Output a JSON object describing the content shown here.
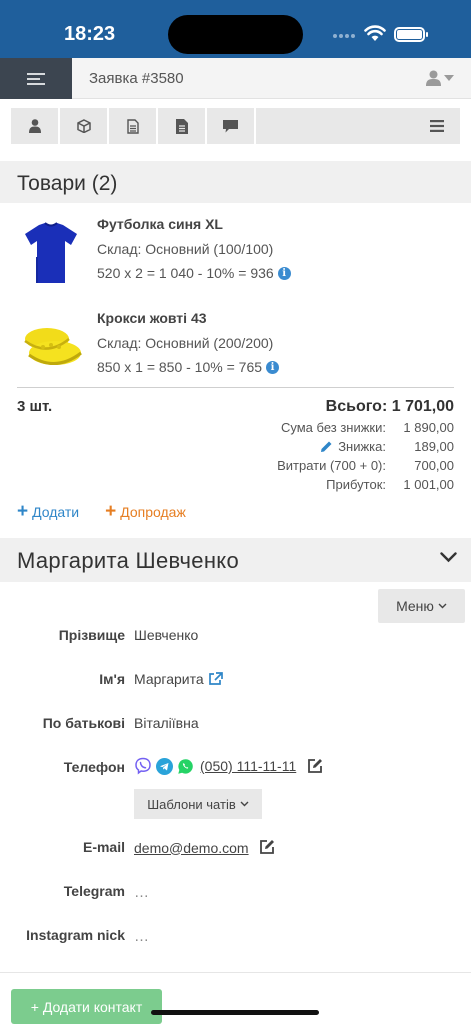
{
  "status_bar": {
    "time": "18:23"
  },
  "header": {
    "title": "Заявка #3580",
    "menu_icon": "hamburger-icon",
    "user_icon": "user-icon"
  },
  "toolbar": {
    "icons": [
      "user-icon",
      "box-icon",
      "document-icon",
      "file-icon",
      "comment-icon",
      "list-icon"
    ]
  },
  "products": {
    "title": "Товари (2)",
    "items": [
      {
        "name": "Футболка синя XL",
        "stock": "Склад: Основний (100/100)",
        "calc": "520 x 2 = 1 040 - 10% = 936",
        "image": "blue-tshirt"
      },
      {
        "name": "Крокси жовті 43",
        "stock": "Склад: Основний (200/200)",
        "calc": "850 x 1 = 850 - 10% = 765",
        "image": "yellow-crocs"
      }
    ],
    "quantity": "3 шт.",
    "total": "Всього: 1 701,00",
    "summary": [
      {
        "label": "Сума без знижки:",
        "value": "1 890,00"
      },
      {
        "label": "Знижка:",
        "value": "189,00",
        "icon": "pencil-icon"
      },
      {
        "label": "Витрати (700 + 0):",
        "value": "700,00"
      },
      {
        "label": "Прибуток:",
        "value": "1 001,00"
      }
    ],
    "add_label": "Додати",
    "upsell_label": "Допродаж"
  },
  "contact": {
    "name": "Маргарита Шевченко",
    "menu_label": "Меню",
    "fields": {
      "surname": {
        "label": "Прізвище",
        "value": "Шевченко"
      },
      "first_name": {
        "label": "Ім'я",
        "value": "Маргарита"
      },
      "patronymic": {
        "label": "По батькові",
        "value": "Віталіївна"
      },
      "phone": {
        "label": "Телефон",
        "value": "(050) 111-11-11"
      },
      "email": {
        "label": "E-mail",
        "value": "demo@demo.com"
      },
      "telegram": {
        "label": "Telegram",
        "value": "…"
      },
      "instagram": {
        "label": "Instagram nick",
        "value": "…"
      }
    },
    "chat_templates_label": "Шаблони чатів",
    "add_contact_label": "+ Додати контакт"
  },
  "colors": {
    "status_bar": "#1f5f9c",
    "accent_blue": "#2f86c8",
    "accent_orange": "#e67e22",
    "add_contact_green": "#7ccc8e",
    "viber": "#7360f2",
    "telegram": "#2aa3d9",
    "whatsapp": "#25d366"
  }
}
